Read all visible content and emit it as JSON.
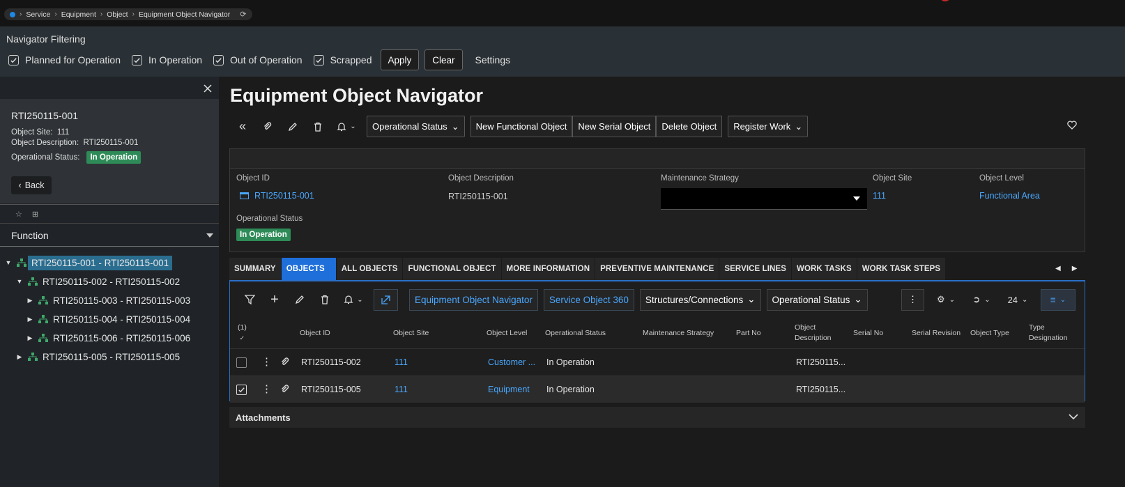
{
  "breadcrumb": {
    "items": [
      "Service",
      "Equipment",
      "Object",
      "Equipment Object Navigator"
    ]
  },
  "filter": {
    "title": "Navigator Filtering",
    "options": [
      {
        "label": "Planned for Operation",
        "checked": true
      },
      {
        "label": "In Operation",
        "checked": true
      },
      {
        "label": "Out of Operation",
        "checked": true
      },
      {
        "label": "Scrapped",
        "checked": true
      }
    ],
    "apply_label": "Apply",
    "clear_label": "Clear",
    "settings_label": "Settings"
  },
  "side": {
    "title": "RTI250115-001",
    "site_label": "Object Site:",
    "site_value": "111",
    "desc_label": "Object Description:",
    "desc_value": "RTI250115-001",
    "status_label": "Operational Status:",
    "status_value": "In Operation",
    "back_label": "Back",
    "function_label": "Function",
    "tree": [
      {
        "label": "RTI250115-001 - RTI250115-001",
        "level": 0,
        "expanded": true,
        "selected": true
      },
      {
        "label": "RTI250115-002 - RTI250115-002",
        "level": 1,
        "expanded": true
      },
      {
        "label": "RTI250115-003 - RTI250115-003",
        "level": 2,
        "expanded": false
      },
      {
        "label": "RTI250115-004 - RTI250115-004",
        "level": 2,
        "expanded": false
      },
      {
        "label": "RTI250115-006 - RTI250115-006",
        "level": 2,
        "expanded": false
      },
      {
        "label": "RTI250115-005 - RTI250115-005",
        "level": 1,
        "expanded": false
      }
    ]
  },
  "main": {
    "title": "Equipment Object Navigator",
    "toolbar": {
      "operational_status": "Operational Status",
      "new_functional": "New Functional Object",
      "new_serial": "New Serial Object",
      "delete_object": "Delete Object",
      "register_work": "Register Work"
    },
    "details": {
      "object_id_label": "Object ID",
      "object_id": "RTI250115-001",
      "object_desc_label": "Object Description",
      "object_desc": "RTI250115-001",
      "maint_label": "Maintenance Strategy",
      "site_label": "Object Site",
      "site": "111",
      "level_label": "Object Level",
      "level": "Functional Area",
      "status_label": "Operational Status",
      "status": "In Operation"
    },
    "tabs": [
      "SUMMARY",
      "OBJECTS",
      "ALL OBJECTS",
      "FUNCTIONAL OBJECT",
      "MORE INFORMATION",
      "PREVENTIVE MAINTENANCE",
      "SERVICE LINES",
      "WORK TASKS",
      "WORK TASK STEPS"
    ],
    "active_tab": "OBJECTS",
    "grid": {
      "buttons": {
        "navigator": "Equipment Object Navigator",
        "service360": "Service Object 360",
        "structures": "Structures/Connections",
        "op_status": "Operational Status",
        "page_size": "24"
      },
      "selected_count": "(1)",
      "columns": [
        "Object ID",
        "Object Site",
        "Object Level",
        "Operational Status",
        "Maintenance Strategy",
        "Part No",
        "Object Description",
        "Serial No",
        "Serial Revision",
        "Object Type",
        "Type Designation"
      ],
      "rows": [
        {
          "id": "RTI250115-002",
          "site": "111",
          "level": "Customer ...",
          "status": "In Operation",
          "desc": "RTI250115...",
          "checked": false
        },
        {
          "id": "RTI250115-005",
          "site": "111",
          "level": "Equipment",
          "status": "In Operation",
          "desc": "RTI250115...",
          "checked": true
        }
      ]
    },
    "attachments_label": "Attachments"
  },
  "colors": {
    "accent": "#1e6fd9",
    "link": "#4aa8ff",
    "status_green": "#2e8b57",
    "tree_icon": "#3fa86b"
  }
}
